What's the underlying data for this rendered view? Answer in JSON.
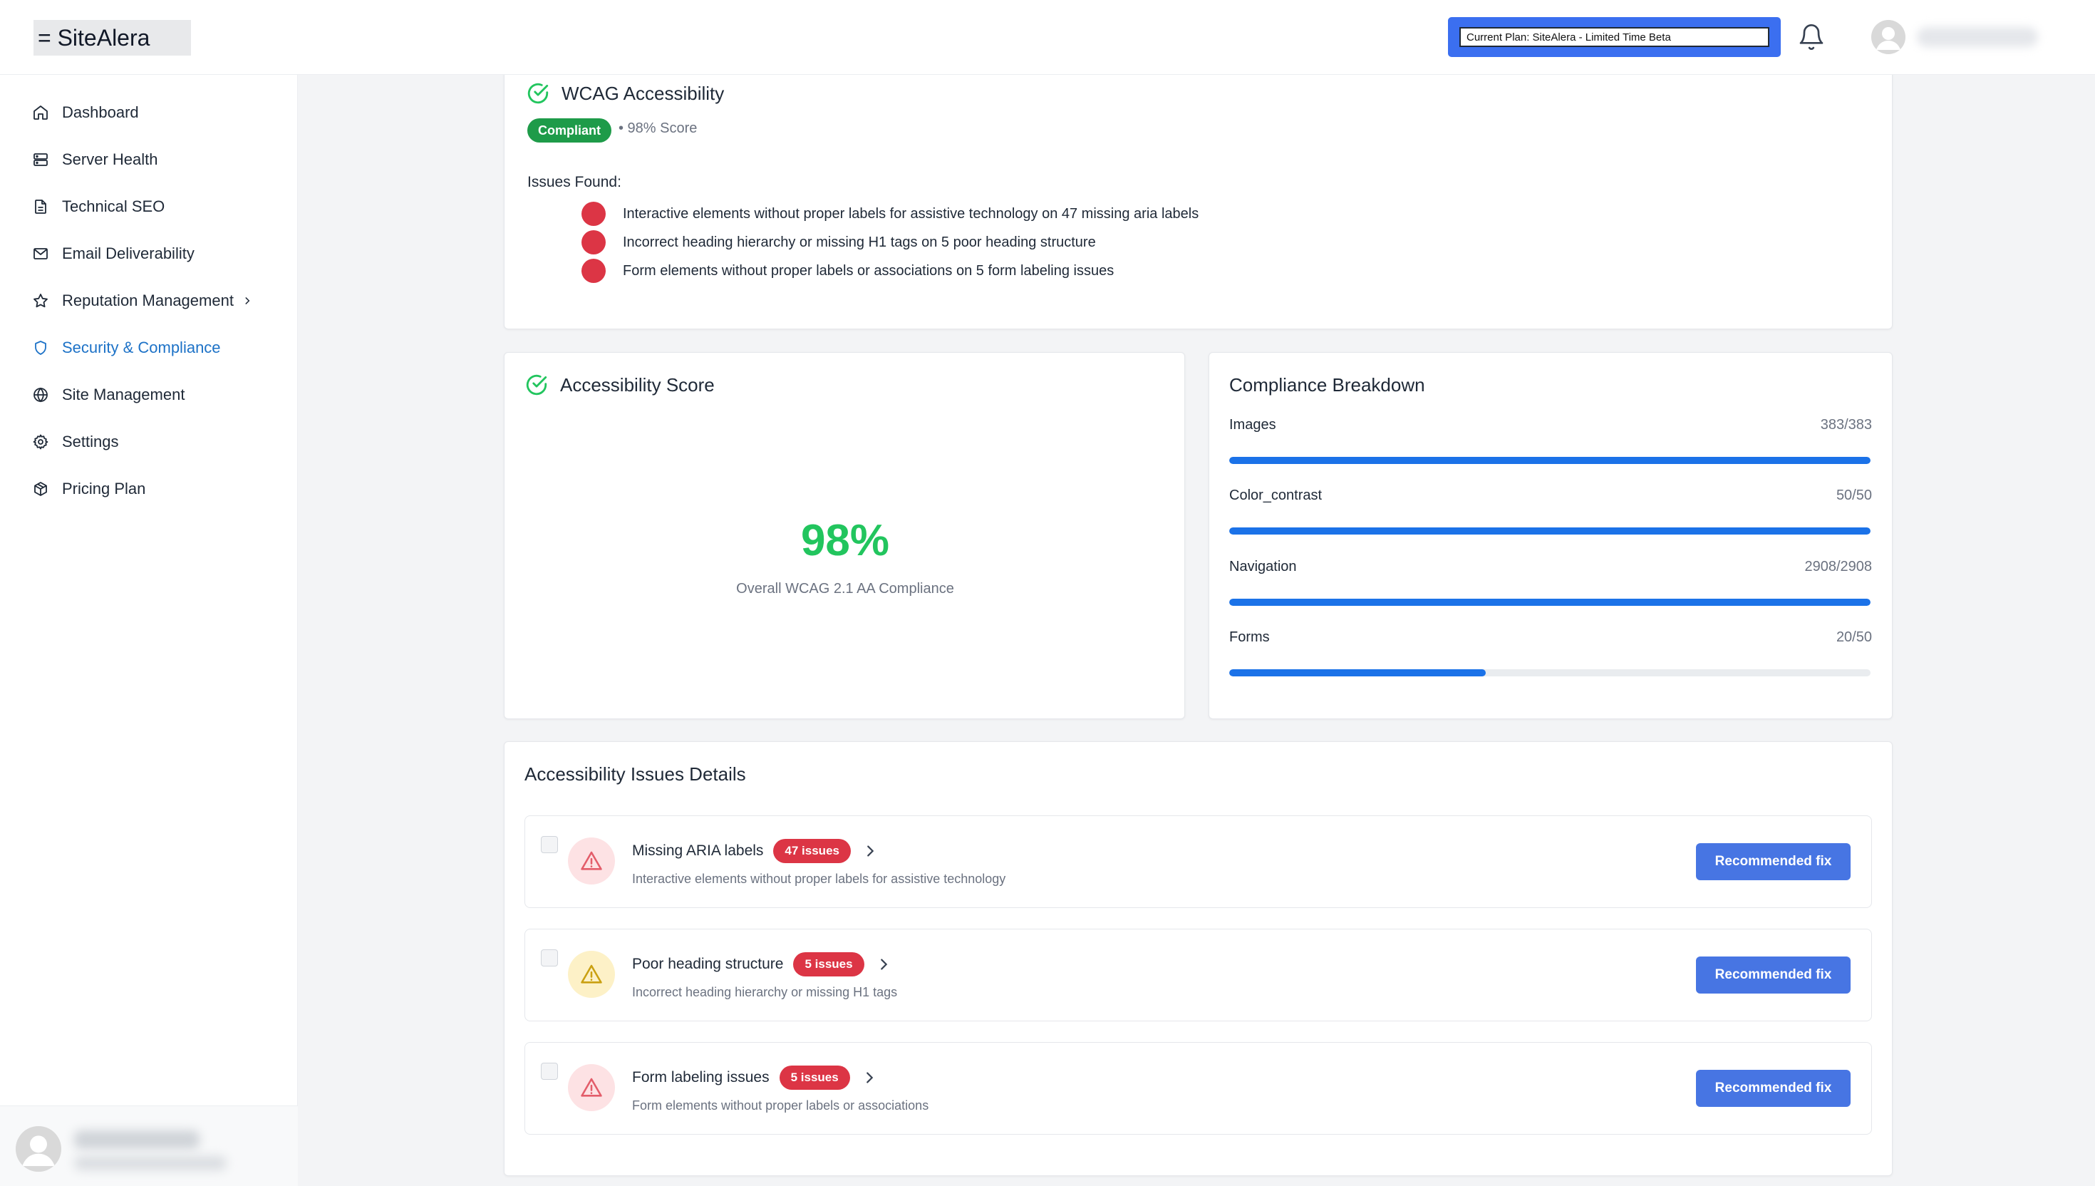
{
  "header": {
    "logo_text": "= SiteAlera",
    "plan_text": "Current Plan: SiteAlera - Limited Time Beta"
  },
  "sidebar": {
    "items": [
      {
        "label": "Dashboard",
        "icon": "home-icon"
      },
      {
        "label": "Server Health",
        "icon": "server-icon"
      },
      {
        "label": "Technical SEO",
        "icon": "document-icon"
      },
      {
        "label": "Email Deliverability",
        "icon": "mail-icon"
      },
      {
        "label": "Reputation Management",
        "icon": "star-icon"
      },
      {
        "label": "Security & Compliance",
        "icon": "shield-icon",
        "active": true
      },
      {
        "label": "Site Management",
        "icon": "globe-icon"
      },
      {
        "label": "Settings",
        "icon": "gear-icon"
      },
      {
        "label": "Pricing Plan",
        "icon": "package-icon"
      }
    ]
  },
  "wcag": {
    "title": "WCAG Accessibility",
    "status_badge": "Compliant",
    "score_text": "• 98% Score",
    "issues_heading": "Issues Found:",
    "issues": [
      "Interactive elements without proper labels for assistive technology on 47 missing aria labels",
      "Incorrect heading hierarchy or missing H1 tags on 5 poor heading structure",
      "Form elements without proper labels or associations on 5 form labeling issues"
    ]
  },
  "score": {
    "title": "Accessibility Score",
    "value": "98%",
    "caption": "Overall WCAG 2.1 AA Compliance"
  },
  "breakdown": {
    "title": "Compliance Breakdown",
    "rows": [
      {
        "label": "Images",
        "value": "383/383",
        "fraction": 1.0
      },
      {
        "label": "Color_contrast",
        "value": "50/50",
        "fraction": 1.0
      },
      {
        "label": "Navigation",
        "value": "2908/2908",
        "fraction": 1.0
      },
      {
        "label": "Forms",
        "value": "20/50",
        "fraction": 0.4
      }
    ]
  },
  "issues_details": {
    "title": "Accessibility Issues Details",
    "fix_label": "Recommended fix",
    "rows": [
      {
        "title": "Missing ARIA labels",
        "badge": "47 issues",
        "desc": "Interactive elements without proper labels for assistive technology",
        "severity": "error"
      },
      {
        "title": "Poor heading structure",
        "badge": "5 issues",
        "desc": "Incorrect heading hierarchy or missing H1 tags",
        "severity": "warning"
      },
      {
        "title": "Form labeling issues",
        "badge": "5 issues",
        "desc": "Form elements without proper labels or associations",
        "severity": "error"
      }
    ]
  },
  "colors": {
    "accent": "#1d72c7",
    "success": "#22c55e",
    "danger": "#dc3545",
    "progress": "#1b72e8",
    "button": "#4775e3"
  }
}
